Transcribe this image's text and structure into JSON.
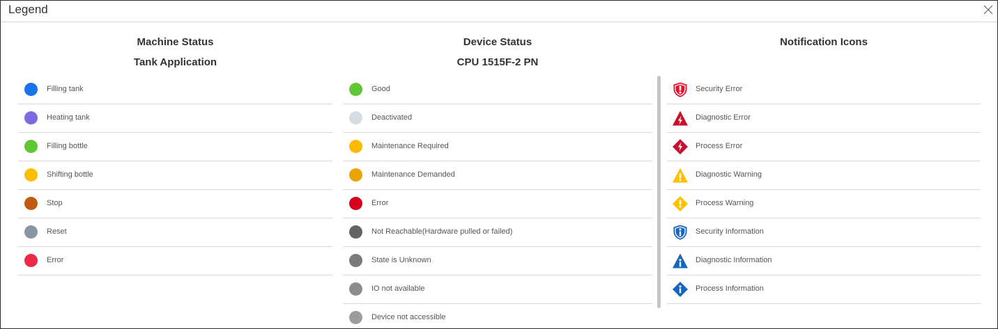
{
  "dialog": {
    "title": "Legend"
  },
  "machine": {
    "heading": "Machine Status",
    "subheading": "Tank Application",
    "items": [
      {
        "label": "Filling tank",
        "color": "#1a73e8"
      },
      {
        "label": "Heating tank",
        "color": "#7b6ae0"
      },
      {
        "label": "Filling bottle",
        "color": "#5fc636"
      },
      {
        "label": "Shifting bottle",
        "color": "#ffbf00"
      },
      {
        "label": "Stop",
        "color": "#c05a10"
      },
      {
        "label": "Reset",
        "color": "#8896a3"
      },
      {
        "label": "Error",
        "color": "#ee2a4a"
      }
    ]
  },
  "device": {
    "heading": "Device Status",
    "subheading": "CPU 1515F-2 PN",
    "items": [
      {
        "label": "Good",
        "color": "#5fc636"
      },
      {
        "label": "Deactivated",
        "color": "#d7dce1"
      },
      {
        "label": "Maintenance Required",
        "color": "#ffba00"
      },
      {
        "label": "Maintenance Demanded",
        "color": "#eaa400"
      },
      {
        "label": "Error",
        "color": "#d4001c"
      },
      {
        "label": "Not Reachable(Hardware pulled or failed)",
        "color": "#636363"
      },
      {
        "label": "State is Unknown",
        "color": "#7a7a7a"
      },
      {
        "label": "IO not available",
        "color": "#8c8c8c"
      },
      {
        "label": "Device not accessible",
        "color": "#9c9c9c"
      }
    ]
  },
  "notifications": {
    "heading": "Notification Icons",
    "items": [
      {
        "label": "Security Error",
        "icon": "shield-exclamation-icon",
        "color": "#e8112d"
      },
      {
        "label": "Diagnostic Error",
        "icon": "triangle-lightning-icon",
        "color": "#c8102e"
      },
      {
        "label": "Process Error",
        "icon": "diamond-lightning-icon",
        "color": "#c8102e"
      },
      {
        "label": "Diagnostic Warning",
        "icon": "triangle-exclamation-icon",
        "color": "#ffc000"
      },
      {
        "label": "Process Warning",
        "icon": "diamond-exclamation-icon",
        "color": "#ffc000"
      },
      {
        "label": "Security Information",
        "icon": "shield-info-icon",
        "color": "#1565c0"
      },
      {
        "label": "Diagnostic Information",
        "icon": "triangle-info-icon",
        "color": "#1565c0"
      },
      {
        "label": "Process Information",
        "icon": "diamond-info-icon",
        "color": "#1565c0"
      }
    ]
  }
}
